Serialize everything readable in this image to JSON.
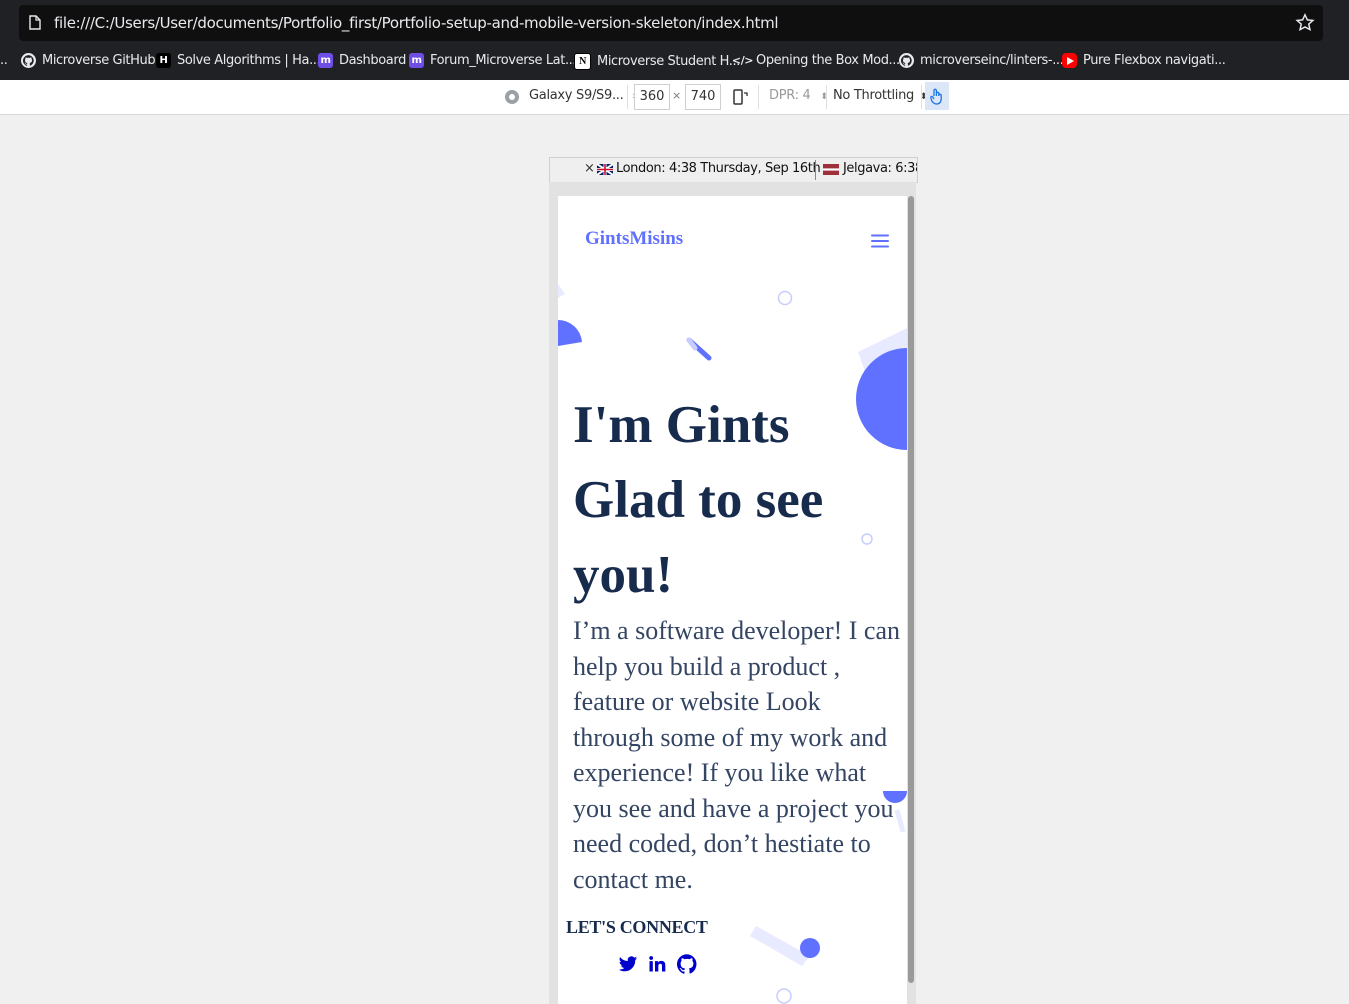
{
  "browser": {
    "url": "file:///C:/Users/User/documents/Portfolio_first/Portfolio-setup-and-mobile-version-skeleton/index.html",
    "bookmarks": [
      {
        "label": "Microverse GitHub",
        "icon": "github-icon"
      },
      {
        "label": "Solve Algorithms | Ha...",
        "icon": "hackerrank-icon"
      },
      {
        "label": "Dashboard",
        "icon": "microverse-icon"
      },
      {
        "label": "Forum_Microverse Lat...",
        "icon": "microverse-icon"
      },
      {
        "label": "Microverse Student H...",
        "icon": "notion-icon"
      },
      {
        "label": "Opening the Box Mod...",
        "icon": "code-icon"
      },
      {
        "label": "microverseinc/linters-...",
        "icon": "github-icon"
      },
      {
        "label": "Pure Flexbox navigati...",
        "icon": "youtube-icon"
      }
    ]
  },
  "devtools": {
    "device": "Galaxy S9/S9...",
    "width": "360",
    "times": "×",
    "height": "740",
    "dpr": "DPR: 4",
    "throttling": "No Throttling"
  },
  "clock": {
    "close": "×",
    "london": "London: 4:38 Thursday, Sep 16th",
    "jelgava": "Jelgava: 6:38"
  },
  "page": {
    "logo": "GintsMisins",
    "hero_title": "I'm Gints Glad to see you!",
    "hero_text": "I’m a software developer! I can help you build a product , feature or website Look through some of my work and experience! If you like what you see and have a project you need coded, don’t hestiate to contact me.",
    "connect_label": "LET'S CONNECT",
    "social": [
      "twitter-icon",
      "linkedin-icon",
      "github-icon"
    ]
  },
  "colors": {
    "accent": "#6070ff",
    "heading": "#172b4d",
    "body_text": "#344563",
    "social": "#0000cc"
  }
}
